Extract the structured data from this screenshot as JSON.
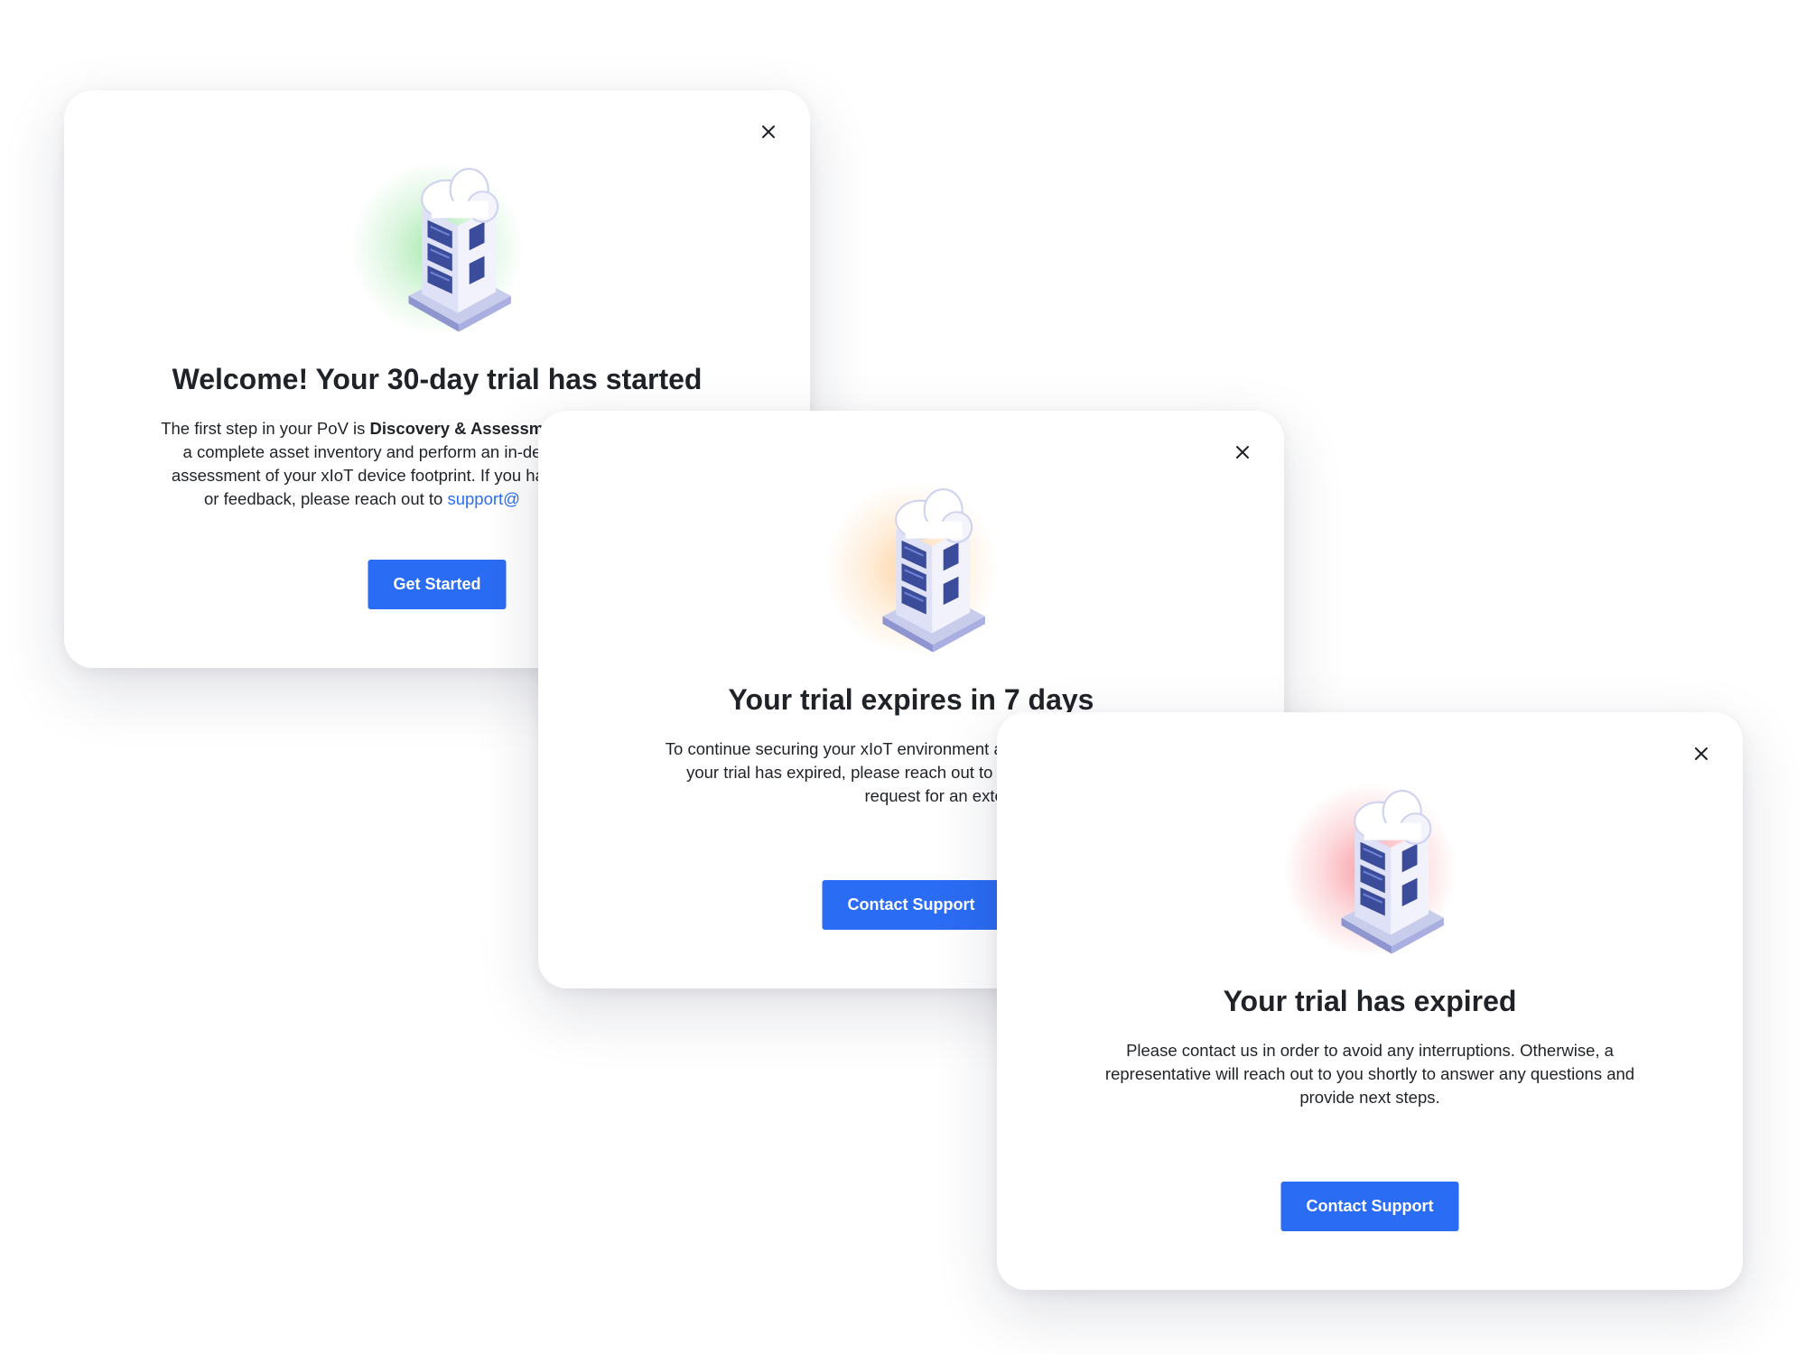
{
  "modals": [
    {
      "glow": "green",
      "glow_color": "#5ed66d",
      "title": "Welcome! Your 30-day trial has started",
      "body_before": "The first step in your PoV is ",
      "body_bold": "Discovery & Assessmen",
      "body_line2": "a complete asset inventory and perform an in-de",
      "body_line3": "assessment of your xIoT device footprint. If you hav",
      "body_line4": "or feedback, please reach out to ",
      "body_link": "support@",
      "button_label": "Get Started",
      "icons": {
        "close": "close-icon",
        "illustration": "cloud-server-icon"
      }
    },
    {
      "glow": "orange",
      "glow_color": "#ffb25c",
      "title": "Your trial expires in 7 days",
      "body_line1": "To continue securing your xIoT environment and av",
      "body_line2": "your trial has expired, please reach out to our su",
      "body_line3": "request for an extension",
      "button_label": "Contact Support",
      "icons": {
        "close": "close-icon",
        "illustration": "cloud-server-icon"
      }
    },
    {
      "glow": "red",
      "glow_color": "#f55c68",
      "title": "Your trial has expired",
      "body_line1": "Please contact us in order to avoid any interruptions. Otherwise, a",
      "body_line2": "representative will reach out to you shortly to answer any questions and",
      "body_line3": "provide next steps.",
      "button_label": "Contact Support",
      "icons": {
        "close": "close-icon",
        "illustration": "cloud-server-icon"
      }
    }
  ],
  "colors": {
    "primary": "#2b6cf4",
    "link": "#2a6ff2",
    "text": "#1f2328"
  }
}
